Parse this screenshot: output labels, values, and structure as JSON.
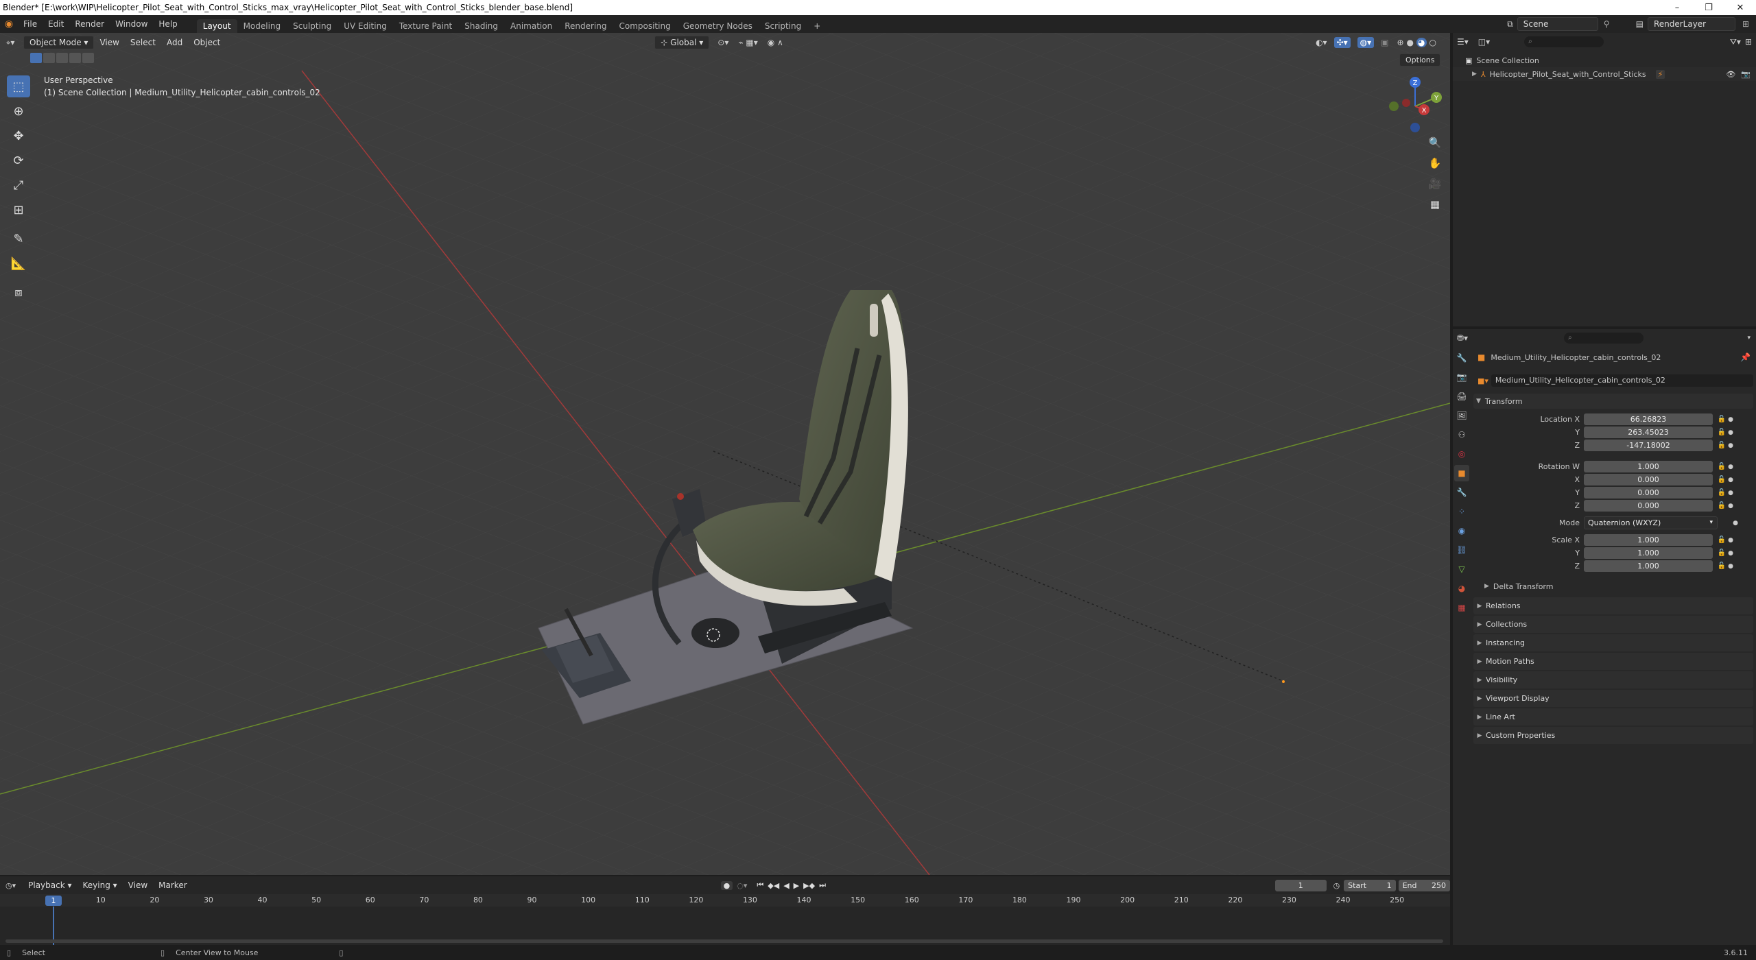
{
  "window": {
    "title": "Blender* [E:\\work\\WIP\\Helicopter_Pilot_Seat_with_Control_Sticks_max_vray\\Helicopter_Pilot_Seat_with_Control_Sticks_blender_base.blend]",
    "minimize": "–",
    "maximize": "❐",
    "close": "✕"
  },
  "menu": {
    "file": "File",
    "edit": "Edit",
    "render": "Render",
    "window": "Window",
    "help": "Help"
  },
  "workspaces": [
    "Layout",
    "Modeling",
    "Sculpting",
    "UV Editing",
    "Texture Paint",
    "Shading",
    "Animation",
    "Rendering",
    "Compositing",
    "Geometry Nodes",
    "Scripting"
  ],
  "add_workspace": "+",
  "scene": {
    "name": "Scene",
    "render_layer": "RenderLayer"
  },
  "viewport": {
    "mode": "Object Mode",
    "view": "View",
    "select": "Select",
    "add": "Add",
    "object": "Object",
    "orientation": "Global",
    "options": "Options",
    "perspective": "User Perspective",
    "collection_info": "(1) Scene Collection | Medium_Utility_Helicopter_cabin_controls_02",
    "gizmo": {
      "x": "X",
      "y": "Y",
      "z": "Z"
    }
  },
  "outliner": {
    "root": "Scene Collection",
    "item": "Helicopter_Pilot_Seat_with_Control_Sticks"
  },
  "properties": {
    "object_name": "Medium_Utility_Helicopter_cabin_controls_02",
    "object_field": "Medium_Utility_Helicopter_cabin_controls_02",
    "transform_title": "Transform",
    "location": {
      "label_x": "Location X",
      "label_y": "Y",
      "label_z": "Z",
      "x": "66.26823",
      "y": "263.45023",
      "z": "-147.18002"
    },
    "rotation": {
      "label_w": "Rotation W",
      "label_x": "X",
      "label_y": "Y",
      "label_z": "Z",
      "w": "1.000",
      "x": "0.000",
      "y": "0.000",
      "z": "0.000"
    },
    "mode_label": "Mode",
    "mode_value": "Quaternion (WXYZ)",
    "scale": {
      "label_x": "Scale X",
      "label_y": "Y",
      "label_z": "Z",
      "x": "1.000",
      "y": "1.000",
      "z": "1.000"
    },
    "delta": "Delta Transform",
    "panels": [
      "Relations",
      "Collections",
      "Instancing",
      "Motion Paths",
      "Visibility",
      "Viewport Display",
      "Line Art",
      "Custom Properties"
    ]
  },
  "timeline": {
    "playback": "Playback",
    "keying": "Keying",
    "view": "View",
    "marker": "Marker",
    "current_frame": "1",
    "start_label": "Start",
    "start": "1",
    "end_label": "End",
    "end": "250",
    "ruler": [
      "10",
      "20",
      "30",
      "40",
      "50",
      "60",
      "70",
      "80",
      "90",
      "100",
      "110",
      "120",
      "130",
      "140",
      "150",
      "160",
      "170",
      "180",
      "190",
      "200",
      "210",
      "220",
      "230",
      "240",
      "250"
    ],
    "playhead": "1"
  },
  "status": {
    "select": "Select",
    "center": "Center View to Mouse",
    "version": "3.6.11"
  },
  "colors": {
    "accent": "#4772b3",
    "x_axis": "#c83a3a",
    "y_axis": "#7ea23a",
    "z_axis": "#3b6fd6"
  }
}
